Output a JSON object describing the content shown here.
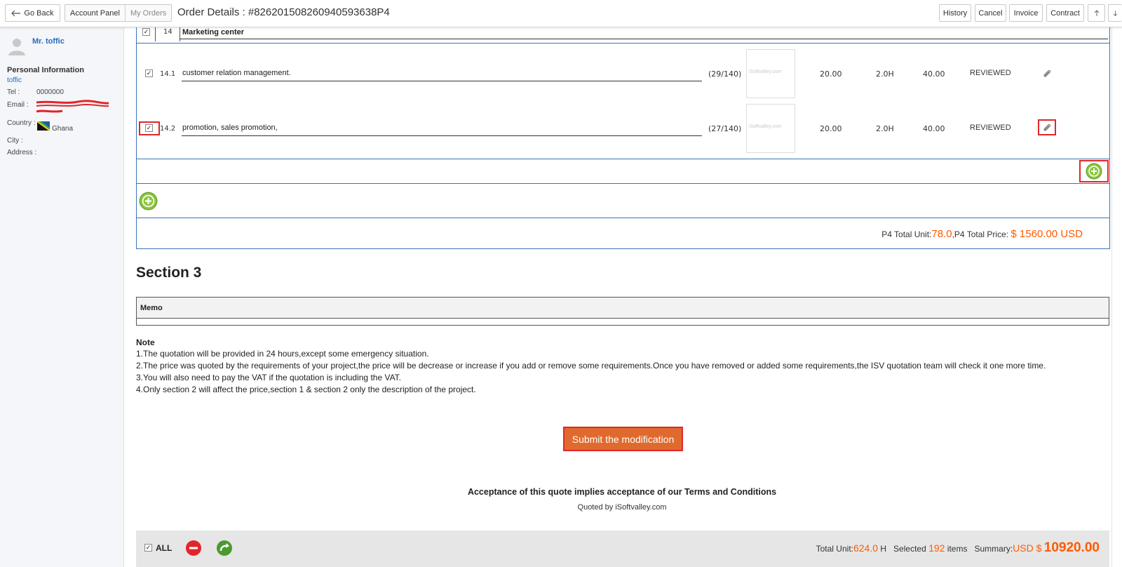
{
  "topbar": {
    "go_back": "Go Back",
    "breadcrumb": [
      "Account Panel",
      "My Orders"
    ],
    "title_prefix": "Order Details : ",
    "order_id": "#826201508260940593638P4",
    "buttons": {
      "history": "History",
      "cancel": "Cancel",
      "invoice": "Invoice",
      "contract": "Contract"
    }
  },
  "sidebar": {
    "user_name": "Mr. toffic",
    "section_title": "Personal Information",
    "name": "toffic",
    "tel_label": "Tel :",
    "tel_value": "0000000",
    "email_label": "Email :",
    "country_label": "Country :",
    "country_value": "Ghana",
    "city_label": "City :",
    "address_label": "Address :"
  },
  "p4": {
    "section": {
      "number": "14",
      "name": "Marketing center"
    },
    "items": [
      {
        "number": "14.1",
        "text": "customer relation management.",
        "count": "(29/140)",
        "thumb_text": "iSoftvalley.com",
        "price": "20.00",
        "hours": "2.0H",
        "amount": "40.00",
        "status": "REVIEWED"
      },
      {
        "number": "14.2",
        "text": "promotion, sales promotion,",
        "count": "(27/140)",
        "thumb_text": "iSoftvalley.com",
        "price": "20.00",
        "hours": "2.0H",
        "amount": "40.00",
        "status": "REVIEWED"
      }
    ],
    "total_unit_label": "P4 Total Unit:",
    "total_unit_value": "78.0",
    "total_price_label": ",P4 Total Price:",
    "total_price_value": "$ 1560.00 USD"
  },
  "section3": {
    "title": "Section 3",
    "memo_label": "Memo"
  },
  "note": {
    "title": "Note",
    "lines": [
      "1.The quotation will be provided in 24 hours,except some emergency situation.",
      "2.The price was quoted by the requirements of your project,the price will be decrease or increase if you add or remove some requirements.Once you have removed or added some requirements,the ISV quotation team will check it one more time.",
      "3.You will also need to pay the VAT if the quotation is including the VAT.",
      "4.Only section 2 will affect the price,section 1 & section 2 only the description of the project."
    ]
  },
  "submit_label": "Submit the modification",
  "acceptance": "Acceptance of this quote implies acceptance of our Terms and Conditions",
  "quoted_by": "Quoted by iSoftvalley.com",
  "bottombar": {
    "all_label": "ALL",
    "total_unit_label": "Total Unit:",
    "total_unit_value": "624.0",
    "unit_suffix": " H",
    "selected_label": "Selected",
    "selected_value": "192",
    "items_label": "items",
    "summary_label": "Summary:",
    "summary_currency": "USD $",
    "summary_value": "10920.00"
  },
  "colors": {
    "accent_orange": "#ff5a00",
    "link_blue": "#2a6bb8",
    "table_border": "#3a74b8",
    "highlight_red": "#e0262c",
    "submit_bg": "#e06a2e"
  }
}
